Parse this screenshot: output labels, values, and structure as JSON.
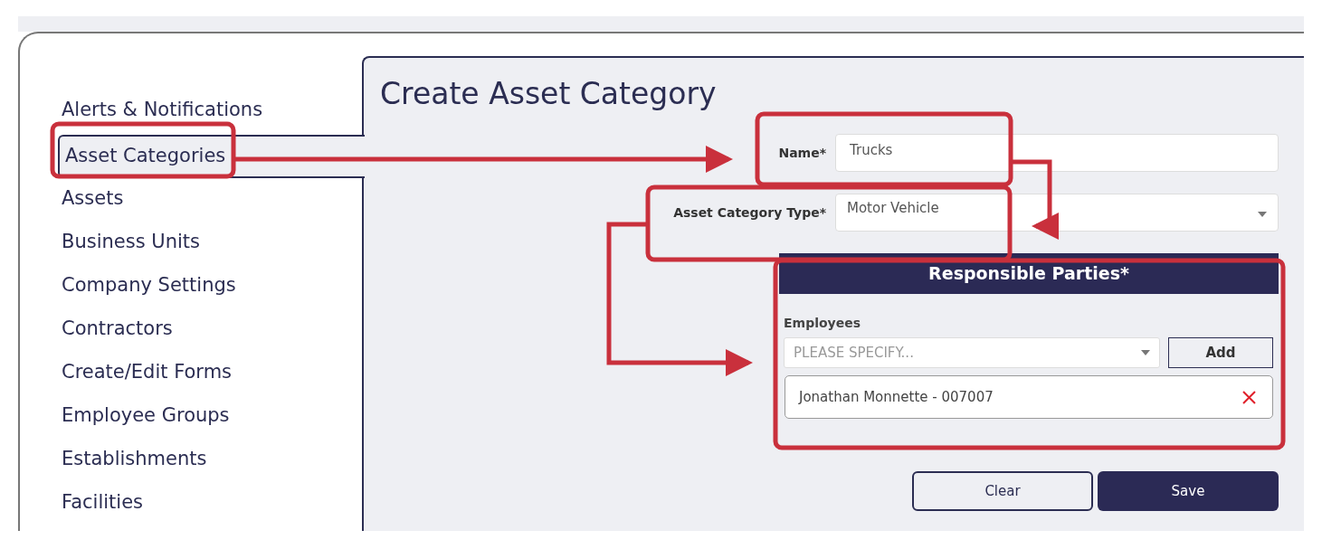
{
  "sidebar": {
    "items": [
      {
        "label": "Alerts & Notifications",
        "selected": false
      },
      {
        "label": "Asset Categories",
        "selected": true
      },
      {
        "label": "Assets",
        "selected": false
      },
      {
        "label": "Business Units",
        "selected": false
      },
      {
        "label": "Company Settings",
        "selected": false
      },
      {
        "label": "Contractors",
        "selected": false
      },
      {
        "label": "Create/Edit Forms",
        "selected": false
      },
      {
        "label": "Employee Groups",
        "selected": false
      },
      {
        "label": "Establishments",
        "selected": false
      },
      {
        "label": "Facilities",
        "selected": false
      }
    ]
  },
  "form": {
    "title": "Create Asset Category",
    "fields": [
      {
        "kind": "text",
        "label": "Name*",
        "value": "Trucks"
      },
      {
        "kind": "select",
        "label": "Asset Category Type*",
        "value": "Motor Vehicle"
      }
    ],
    "responsible_parties": {
      "title": "Responsible Parties*",
      "employees_label": "Employees",
      "placeholder": "PLEASE SPECIFY...",
      "add_button": "Add",
      "entries": [
        {
          "text": "Jonathan Monnette - 007007"
        }
      ]
    },
    "buttons": [
      {
        "kind": "secondary",
        "label": "Clear"
      },
      {
        "kind": "primary",
        "label": "Save"
      }
    ]
  }
}
